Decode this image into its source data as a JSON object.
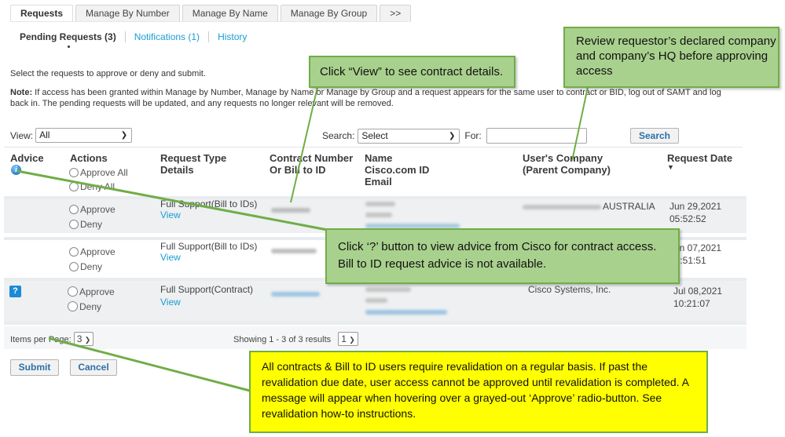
{
  "tabs": [
    {
      "label": "Requests",
      "active": true
    },
    {
      "label": "Manage By Number",
      "active": false
    },
    {
      "label": "Manage By Name",
      "active": false
    },
    {
      "label": "Manage By Group",
      "active": false
    },
    {
      "label": ">>",
      "active": false
    }
  ],
  "subnav": {
    "pending": "Pending Requests (3)",
    "notifications": "Notifications (1)",
    "history": "History"
  },
  "instructions": "Select the requests to approve or deny and submit.",
  "note": {
    "label": "Note:",
    "text": " If access has been granted within Manage by Number, Manage by Name or Manage by Group and a request appears for the same user to contract or BID, log out of SAMT and log back in. The pending requests will be updated, and any requests no longer relevant will be removed."
  },
  "filter": {
    "view_label": "View:",
    "view_value": "All",
    "search_label": "Search:",
    "search_value": "Select",
    "for_label": "For:",
    "for_value": "",
    "search_button": "Search"
  },
  "table": {
    "headers": {
      "advice": "Advice",
      "actions": "Actions",
      "approve_all": "Approve All",
      "deny_all": "Deny All",
      "request_type_1": "Request Type",
      "request_type_2": "Details",
      "contract_1": "Contract Number",
      "contract_2": "Or Bill to ID",
      "name_1": "Name",
      "name_2": "Cisco.com ID",
      "name_3": "Email",
      "company_1": "User's Company",
      "company_2": "(Parent Company)",
      "date": "Request Date"
    },
    "rows": [
      {
        "advice": "",
        "approve": "Approve",
        "deny": "Deny",
        "request_type": "Full Support(Bill to IDs)",
        "view": "View",
        "company": "AUSTRALIA",
        "date": "Jun 29,2021",
        "time": "05:52:52"
      },
      {
        "advice": "",
        "approve": "Approve",
        "deny": "Deny",
        "request_type": "Full Support(Bill to IDs)",
        "view": "View",
        "company": "",
        "date": "Jun 07,2021",
        "time": "05:51:51"
      },
      {
        "advice": "?",
        "approve": "Approve",
        "deny": "Deny",
        "request_type": "Full Support(Contract)",
        "view": "View",
        "company": "Cisco Systems, Inc.",
        "date": "Jul 08,2021",
        "time": "10:21:07"
      }
    ]
  },
  "pagination": {
    "items_per_page_label": "Items per Page:",
    "items_per_page": "3",
    "showing": "Showing 1 - 3 of 3 results",
    "page": "1"
  },
  "buttons": {
    "submit": "Submit",
    "cancel": "Cancel"
  },
  "callouts": {
    "view": "Click “View” to see contract details.",
    "company": "Review requestor’s declared company and company’s HQ before approving access",
    "advice_line1": "Click ‘?’ button to view advice from Cisco for contract access.",
    "advice_line2": "Bill to ID request advice is not available.",
    "revalidation": "All contracts & Bill to ID users require revalidation on a regular basis. If past the revalidation due date, user access cannot be approved until revalidation is completed. A message will appear when hovering over a grayed-out ‘Approve’ radio-button. See revalidation how-to instructions."
  },
  "colors": {
    "link": "#1a9dd4",
    "callout_green": "#a9d18e",
    "callout_border": "#70ad47",
    "callout_yellow": "#ffff00",
    "row_gray": "#eef0f1"
  }
}
